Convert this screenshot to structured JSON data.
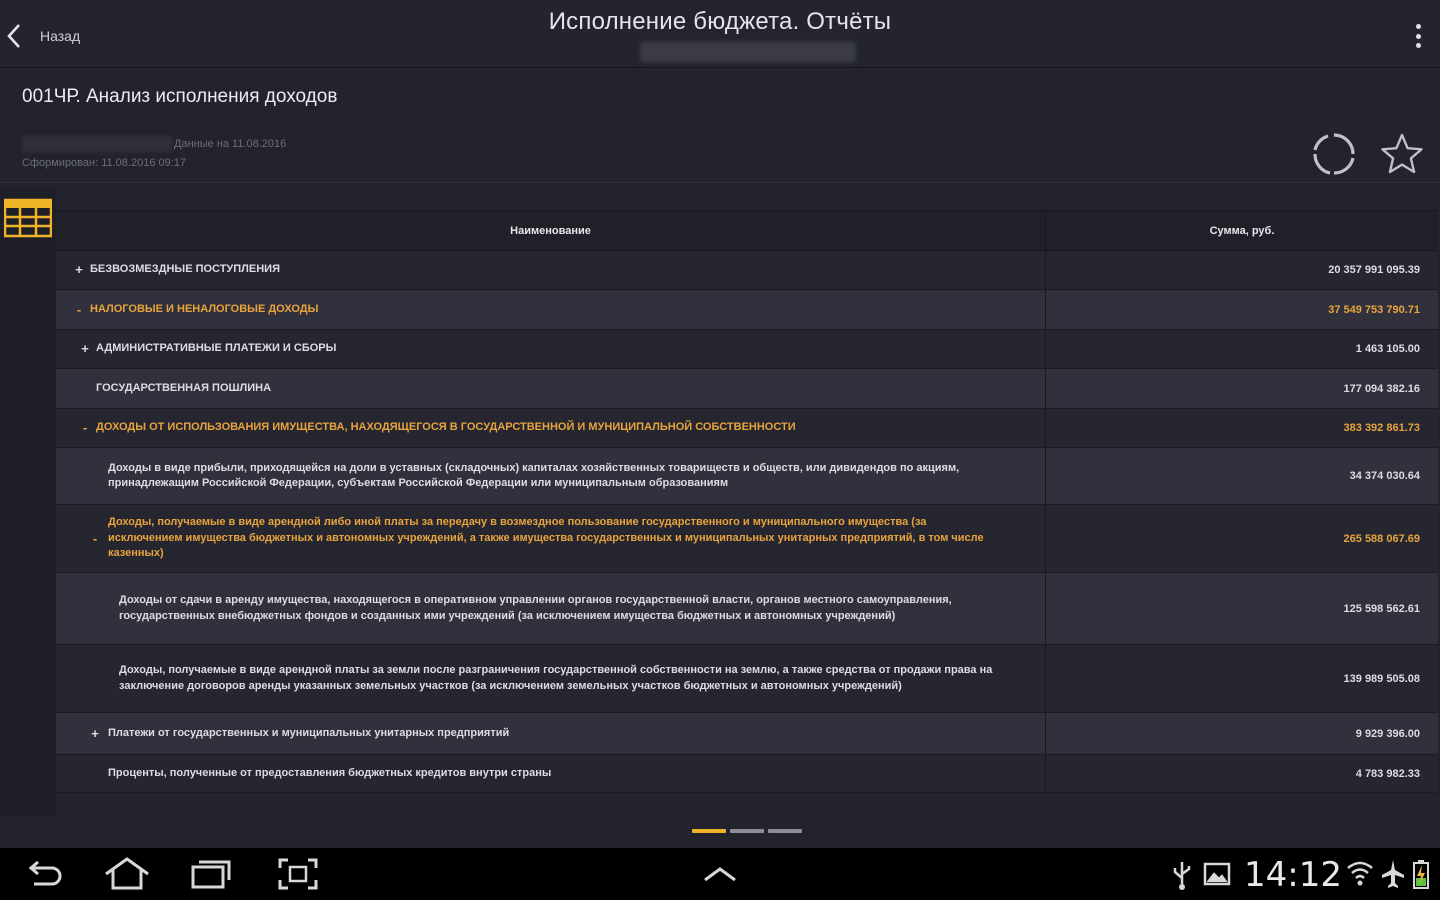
{
  "topbar": {
    "back_label": "Назад",
    "title": "Исполнение бюджета. Отчёты"
  },
  "report": {
    "title": "001ЧР. Анализ исполнения доходов",
    "data_date": "Данные на 11.08.2016",
    "generated": "Сформирован: 11.08.2016 09:17"
  },
  "table": {
    "headers": {
      "name": "Наименование",
      "sum": "Сумма, руб."
    },
    "rows": [
      {
        "marker": "+",
        "name": "Безвозмездные поступления",
        "sum": "20 357 991 095.39"
      },
      {
        "marker": "-",
        "name": "Налоговые и неналоговые доходы",
        "sum": "37 549 753 790.71"
      },
      {
        "marker": "+",
        "name": "Административные платежи и сборы",
        "sum": "1 463 105.00"
      },
      {
        "marker": "",
        "name": "Государственная пошлина",
        "sum": "177 094 382.16"
      },
      {
        "marker": "-",
        "name": "Доходы от использования имущества, находящегося в государственной и муниципальной собственности",
        "sum": "383 392 861.73"
      },
      {
        "marker": "",
        "name": "Доходы в виде прибыли, приходящейся на доли в уставных (складочных) капиталах хозяйственных товариществ и обществ, или дивидендов по акциям, принадлежащим Российской Федерации, субъектам Российской Федерации или муниципальным образованиям",
        "sum": "34 374 030.64"
      },
      {
        "marker": "-",
        "name": "Доходы, получаемые в виде арендной либо иной платы за передачу в возмездное пользование государственного и муниципального имущества (за исключением имущества бюджетных и автономных учреждений, а также имущества государственных и муниципальных унитарных предприятий, в том числе казенных)",
        "sum": "265 588 067.69"
      },
      {
        "marker": "",
        "name": "Доходы от сдачи в аренду имущества, находящегося в оперативном управлении органов государственной власти, органов местного самоуправления, государственных внебюджетных фондов и созданных ими учреждений (за исключением имущества бюджетных и автономных учреждений)",
        "sum": "125 598 562.61"
      },
      {
        "marker": "",
        "name": "Доходы, получаемые в виде арендной платы за земли после разграничения государственной собственности на землю, а также средства от продажи права на заключение договоров аренды указанных земельных участков (за исключением земельных участков бюджетных и автономных учреждений)",
        "sum": "139 989 505.08"
      },
      {
        "marker": "+",
        "name": "Платежи от государственных и муниципальных унитарных предприятий",
        "sum": "9 929 396.00"
      },
      {
        "marker": "",
        "name": "Проценты, полученные от предоставления бюджетных кредитов внутри страны",
        "sum": "4 783 982.33"
      }
    ]
  },
  "pager": {
    "pages": 3,
    "active": 1
  },
  "statusbar": {
    "time": "14:12"
  },
  "colors": {
    "accent": "#e8a33d",
    "pager_active": "#f0b429",
    "background": "#22232c"
  }
}
